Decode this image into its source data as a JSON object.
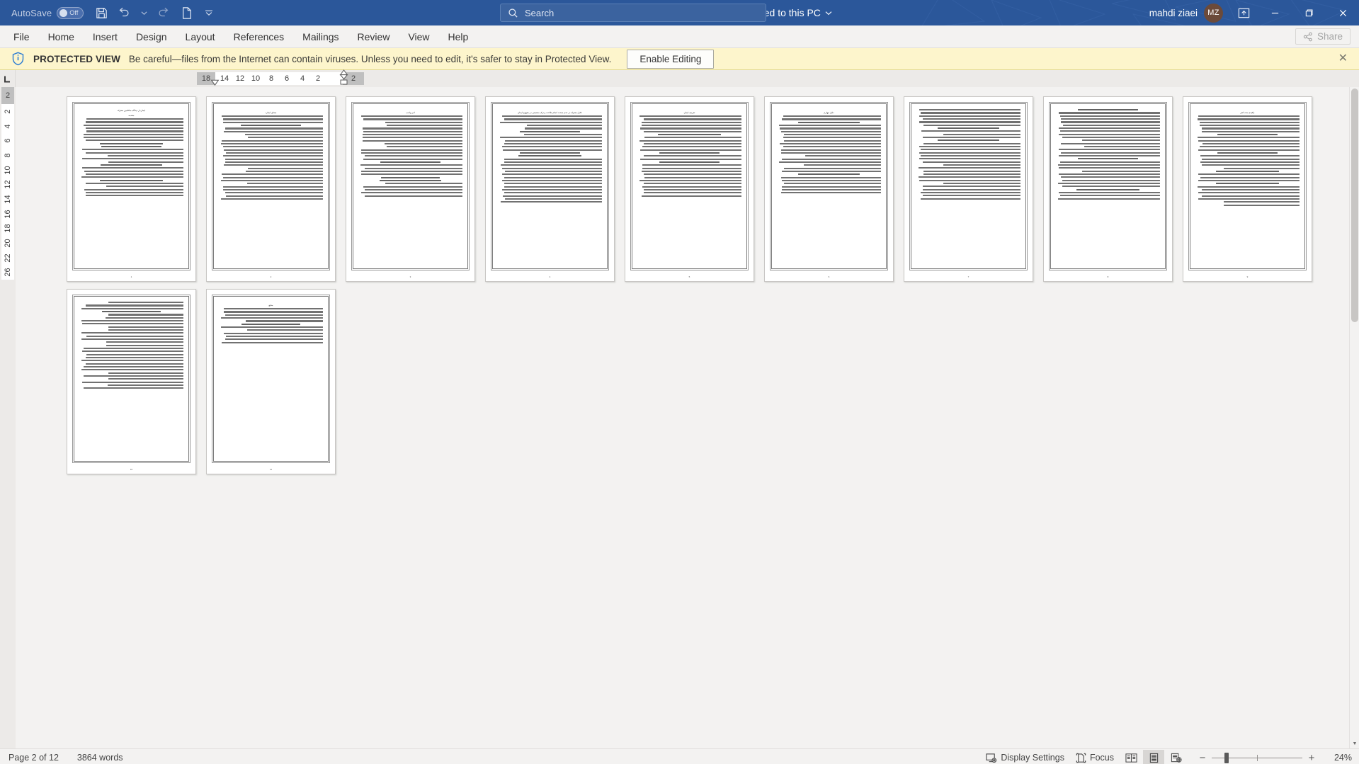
{
  "titlebar": {
    "autosave_label": "AutoSave",
    "autosave_state": "Off",
    "save_icon": "save-icon",
    "undo_icon": "undo-icon",
    "redo_icon": "redo-icon",
    "newdoc_icon": "new-document-icon",
    "customize_icon": "chevron-down-icon",
    "doc_name": "ایمان از دیدگاه متکلمین معتزله",
    "sep1": "-",
    "protected_view": "Protected View",
    "sep2": "-",
    "saved_state": "Saved to this PC",
    "saved_chevron": "chevron-down-icon",
    "search_placeholder": "Search",
    "search_icon": "search-icon",
    "account_name": "mahdi ziaei",
    "account_initials": "MZ",
    "ribbon_display_icon": "ribbon-display-options-icon",
    "minimize": "minimize-icon",
    "restore": "restore-icon",
    "close": "close-icon",
    "accent_color": "#2b579a"
  },
  "ribbon": {
    "tabs": [
      {
        "label": "File"
      },
      {
        "label": "Home"
      },
      {
        "label": "Insert"
      },
      {
        "label": "Design"
      },
      {
        "label": "Layout"
      },
      {
        "label": "References"
      },
      {
        "label": "Mailings"
      },
      {
        "label": "Review"
      },
      {
        "label": "View"
      },
      {
        "label": "Help"
      }
    ],
    "share_label": "Share",
    "share_icon": "share-icon"
  },
  "protected_view": {
    "icon": "shield-info-icon",
    "title": "PROTECTED VIEW",
    "message": "Be careful—files from the Internet can contain viruses. Unless you need to edit, it's safer to stay in Protected View.",
    "enable_button": "Enable Editing",
    "close_icon": "close-icon",
    "bg_color": "#fdf5cc"
  },
  "ruler": {
    "tabstop_icon": "tab-stop-left-icon",
    "horizontal_left_margin": "18",
    "horizontal_ticks": [
      "14",
      "12",
      "10",
      "8",
      "6",
      "4",
      "2"
    ],
    "horizontal_right_margin": "2",
    "vertical_top_margin": "2",
    "vertical_ticks": [
      "2",
      "4",
      "6",
      "8",
      "10",
      "12",
      "14",
      "16",
      "18",
      "20",
      "22",
      "26"
    ]
  },
  "document": {
    "zoom_percent_label": "24%",
    "pages": [
      {
        "number": "1",
        "title": "ایمان از دیدگاه متکلمین معتزله",
        "heading": "مقدمه",
        "lines": 26
      },
      {
        "number": "2",
        "heading": "معنای ایمان:",
        "lines": 28
      },
      {
        "number": "3",
        "heading": "امر واجب",
        "lines": 27
      },
      {
        "number": "4",
        "heading": "دلایل معتزله در عدم صحت انجام طاعت و ترک معصیتی در مفهوم ایمان",
        "lines": 29
      },
      {
        "number": "5",
        "heading": "تعریف ایمان",
        "lines": 27
      },
      {
        "number": "6",
        "heading": "دلیل چهارم",
        "lines": 26
      },
      {
        "number": "7",
        "heading": "",
        "lines": 30
      },
      {
        "number": "8",
        "heading": "",
        "lines": 30
      },
      {
        "number": "9",
        "heading": "چکیده بحث کفر",
        "lines": 30
      },
      {
        "number": "10",
        "heading": "",
        "lines": 29
      },
      {
        "number": "11",
        "heading": "منابع",
        "lines": 12
      }
    ]
  },
  "statusbar": {
    "page_status": "Page 2 of 12",
    "word_count": "3864 words",
    "display_settings_label": "Display Settings",
    "display_settings_icon": "display-settings-icon",
    "focus_label": "Focus",
    "focus_icon": "focus-mode-icon",
    "view_read_icon": "read-mode-icon",
    "view_print_icon": "print-layout-icon",
    "view_web_icon": "web-layout-icon",
    "zoom_out_icon": "zoom-out-icon",
    "zoom_in_icon": "zoom-in-icon",
    "zoom_level": "24%"
  }
}
